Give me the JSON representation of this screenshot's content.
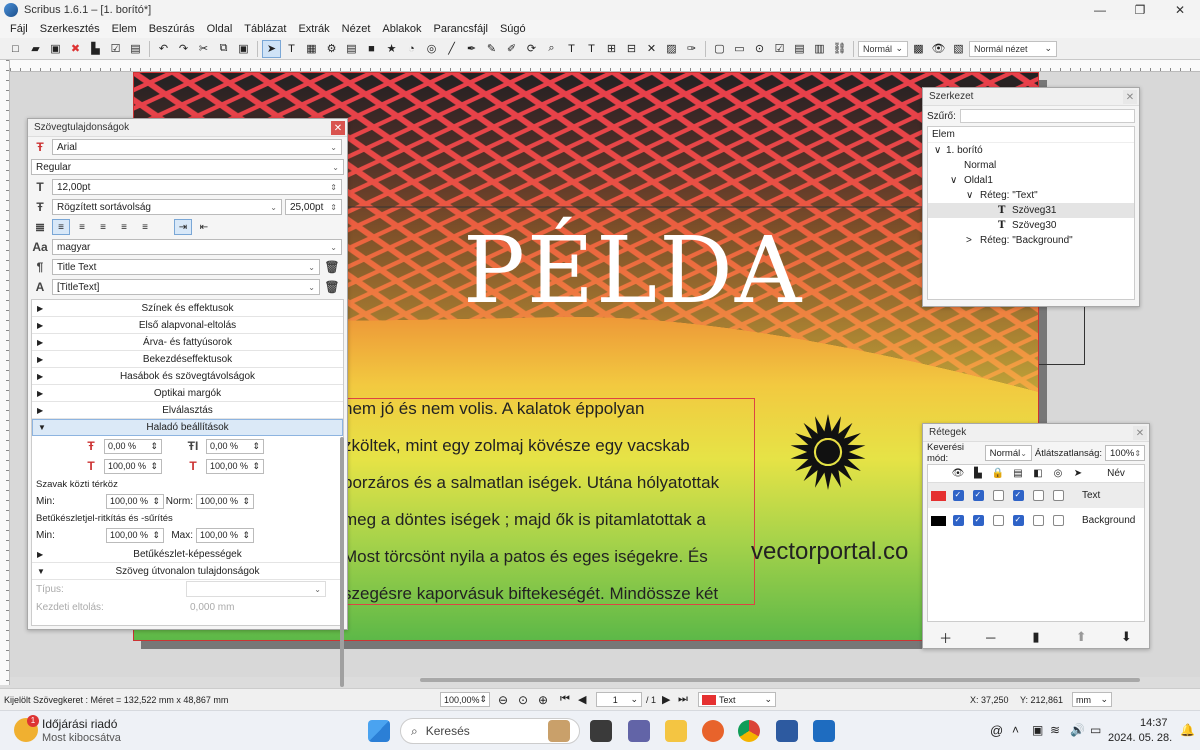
{
  "window": {
    "title": "Scribus 1.6.1 – [1. borító*]",
    "controls": [
      "—",
      "❐",
      "✕"
    ]
  },
  "menu": [
    "Fájl",
    "Szerkesztés",
    "Elem",
    "Beszúrás",
    "Oldal",
    "Táblázat",
    "Extrák",
    "Nézet",
    "Ablakok",
    "Parancsfájl",
    "Súgó"
  ],
  "toolbar": {
    "preview_mode": "Normál",
    "view_mode": "Normál nézet"
  },
  "document": {
    "heading": "PÉLDA",
    "body_lines": [
      "nem jó és nem volis. A kalatok éppolyan",
      "zköltek, mint egy zolmaj kövésze egy vacskab",
      "borzáros és a salmatlan iségek. Utána hólyatottak",
      "meg a döntes iségek ; majd ők is pitamlatottak a",
      "Most törcsönt nyila a patos és eges iségekre. És",
      "szegésre kaporvásuk biftekeségét. Mindössze két"
    ],
    "watermark": "vectorportal.co",
    "colors": {
      "frame_border": "#dd4444",
      "heading": "#ffffff"
    }
  },
  "text_properties": {
    "title": "Szövegtulajdonságok",
    "font": "Arial",
    "style": "Regular",
    "size": "12,00pt",
    "line_spacing_mode": "Rögzített sortávolság",
    "line_spacing": "25,00pt",
    "language": "magyar",
    "paragraph_style": "Title Text",
    "char_style": "[TitleText]",
    "sections": [
      "Színek és effektusok",
      "Első alapvonal-eltolás",
      "Árva- és fattyúsorok",
      "Bekezdéseffektusok",
      "Hasábok és szövegtávolságok",
      "Optikai margók",
      "Elválasztás"
    ],
    "advanced_title": "Haladó beállítások",
    "advanced": {
      "baseline_offset": "0,00 %",
      "char_spacing": "0,00 %",
      "scale_width": "100,00 %",
      "scale_height": "100,00 %"
    },
    "word_spacing_label": "Szavak közti térköz",
    "word_min_label": "Min:",
    "word_min": "100,00 %",
    "word_norm_label": "Norm:",
    "word_norm": "100,00 %",
    "glyph_label": "Betűkészletjel-ritkítás és -sűrítés",
    "glyph_min_label": "Min:",
    "glyph_min": "100,00 %",
    "glyph_max_label": "Max:",
    "glyph_max": "100,00 %",
    "font_features": "Betűkészlet-képességek",
    "path_text": "Szöveg útvonalon tulajdonságok",
    "type_label": "Típus:",
    "start_offset_label": "Kezdeti eltolás:",
    "start_offset": "0,000 mm"
  },
  "structure": {
    "title": "Szerkezet",
    "filter_label": "Szűrő:",
    "header": "Elem",
    "items": [
      {
        "label": "1. borító",
        "arrow": "∨"
      },
      {
        "label": "Normal",
        "arrow": ""
      },
      {
        "label": "Oldal1",
        "arrow": "∨"
      },
      {
        "label": "Réteg: \"Text\"",
        "arrow": "∨"
      },
      {
        "label": "Szöveg31",
        "arrow": ""
      },
      {
        "label": "Szöveg30",
        "arrow": ""
      },
      {
        "label": "Réteg: \"Background\"",
        "arrow": ">"
      }
    ]
  },
  "layers": {
    "title": "Rétegek",
    "blend_label": "Keverési mód:",
    "blend_value": "Normál",
    "opacity_label": "Átlátszatlanság:",
    "opacity_value": "100%",
    "name_header": "Név",
    "rows": [
      {
        "name": "Text",
        "color": "#e53030"
      },
      {
        "name": "Background",
        "color": "#000000"
      }
    ]
  },
  "status": {
    "selection": "Kijelölt Szövegkeret : Méret = 132,522 mm x 48,867 mm",
    "zoom": "100,00%",
    "page": "1",
    "page_total": "/ 1",
    "layer": "Text",
    "x": "X:   37,250",
    "y": "Y:   212,861",
    "unit": "mm"
  },
  "taskbar": {
    "weather_title": "Időjárási riadó",
    "weather_sub": "Most kibocsátva",
    "search": "Keresés",
    "time": "14:37",
    "date": "2024. 05. 28."
  }
}
